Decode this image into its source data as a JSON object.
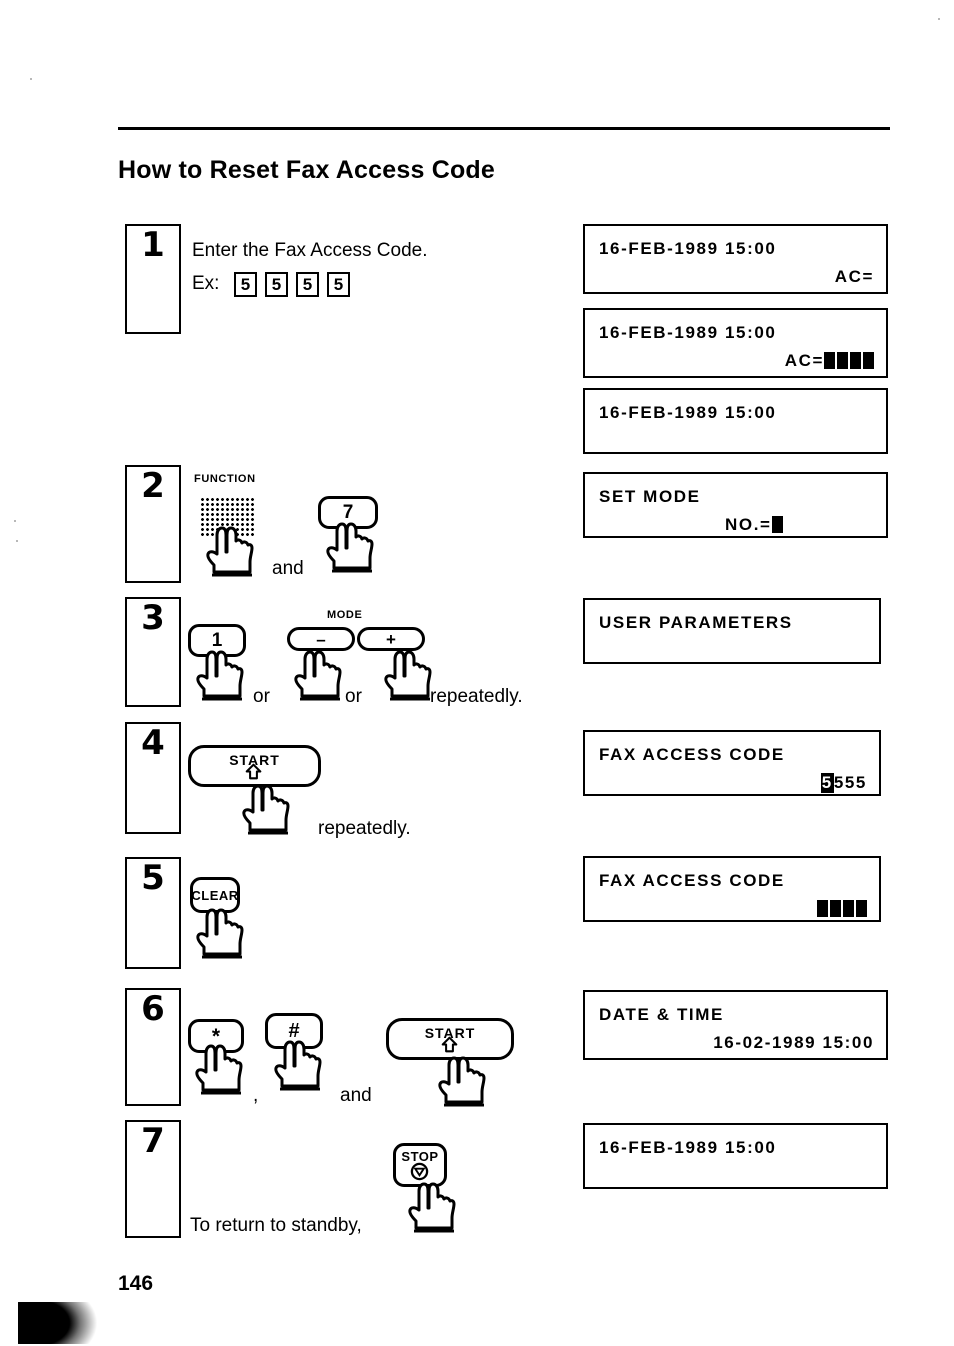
{
  "document": {
    "title": "How to Reset Fax Access Code",
    "page_number": "146"
  },
  "steps": [
    {
      "number": "1",
      "instruction": "Enter the Fax Access Code.",
      "example_label": "Ex:",
      "example_keys": [
        "5",
        "5",
        "5",
        "5"
      ]
    },
    {
      "number": "2",
      "function_label": "FUNCTION",
      "keys": [
        "FUNCTION",
        "7"
      ],
      "conjunction": "and"
    },
    {
      "number": "3",
      "mode_label": "MODE",
      "keys": [
        "1",
        "–",
        "+"
      ],
      "separator_1": "or",
      "separator_2": "or",
      "trailing": "repeatedly."
    },
    {
      "number": "4",
      "keys": [
        "START"
      ],
      "trailing": "repeatedly."
    },
    {
      "number": "5",
      "keys": [
        "CLEAR"
      ]
    },
    {
      "number": "6",
      "keys": [
        "*",
        "#",
        "START"
      ],
      "separator_1": ",",
      "conjunction": "and"
    },
    {
      "number": "7",
      "instruction": "To return to standby,",
      "keys": [
        "STOP"
      ]
    }
  ],
  "displays": [
    {
      "id": "display-1",
      "line1": "16-FEB-1989  15:00",
      "line2": "AC=",
      "line2_align": "right",
      "cursors": 0
    },
    {
      "id": "display-2",
      "line1": "16-FEB-1989  15:00",
      "line2": "AC=",
      "line2_align": "right",
      "cursors": 4
    },
    {
      "id": "display-3",
      "line1": "16-FEB-1989  15:00",
      "line2": "",
      "line2_align": "left",
      "cursors": 0
    },
    {
      "id": "display-4",
      "line1": "SET  MODE",
      "line2": "NO.=",
      "line2_align": "right",
      "cursors": 1
    },
    {
      "id": "display-5",
      "line1": "USER  PARAMETERS",
      "line2": "",
      "line2_align": "left",
      "cursors": 0
    },
    {
      "id": "display-6",
      "line1": "FAX  ACCESS  CODE",
      "line2_inverted": "5",
      "line2_plain": "555",
      "line2_align": "right",
      "cursors": 0
    },
    {
      "id": "display-7",
      "line1": "FAX  ACCESS  CODE",
      "line2": "",
      "line2_align": "right",
      "cursors": 4
    },
    {
      "id": "display-8",
      "line1": "DATE  &  TIME",
      "line2": "16-02-1989  15:00",
      "line2_align": "right",
      "cursors": 0
    },
    {
      "id": "display-9",
      "line1": "16-FEB-1989  15:00",
      "line2": "",
      "line2_align": "left",
      "cursors": 0
    }
  ],
  "colors": {
    "ink": "#000000",
    "paper": "#ffffff"
  }
}
